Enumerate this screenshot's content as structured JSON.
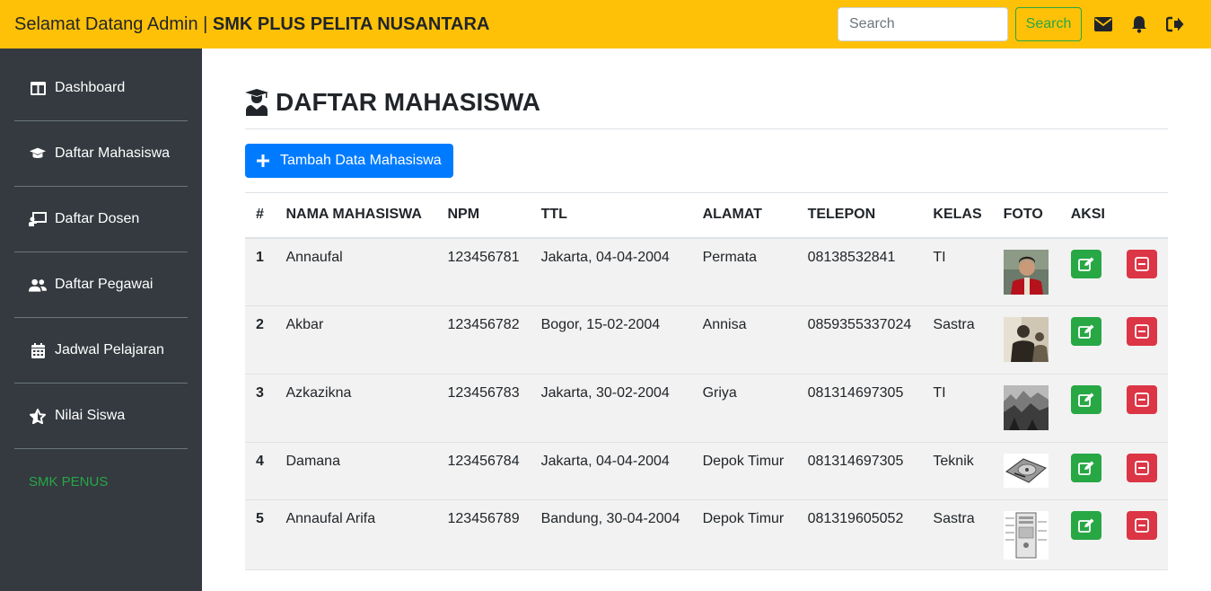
{
  "navbar": {
    "welcome": "Selamat Datang Admin | ",
    "school": "SMK PLUS PELITA NUSANTARA",
    "search_placeholder": "Search",
    "search_button": "Search",
    "icons": [
      "envelope-icon",
      "bell-icon",
      "sign-out-icon"
    ],
    "color": "#ffc107"
  },
  "sidebar": {
    "items": [
      {
        "label": "Dashboard",
        "icon": "columns-icon"
      },
      {
        "label": "Daftar Mahasiswa",
        "icon": "graduation-cap-icon"
      },
      {
        "label": "Daftar Dosen",
        "icon": "chalkboard-teacher-icon"
      },
      {
        "label": "Daftar Pegawai",
        "icon": "users-icon"
      },
      {
        "label": "Jadwal Pelajaran",
        "icon": "calendar-icon"
      },
      {
        "label": "Nilai Siswa",
        "icon": "star-icon"
      }
    ],
    "footer": "SMK PENUS"
  },
  "main": {
    "title": "DAFTAR MAHASISWA",
    "add_button": "Tambah Data Mahasiswa",
    "table": {
      "headers": [
        "#",
        "NAMA MAHASISWA",
        "NPM",
        "TTL",
        "ALAMAT",
        "TELEPON",
        "KELAS",
        "FOTO",
        "AKSI"
      ],
      "rows": [
        {
          "no": "1",
          "nama": "Annaufal",
          "npm": "123456781",
          "ttl": "Jakarta, 04-04-2004",
          "alamat": "Permata",
          "telepon": "08138532841",
          "kelas": "TI"
        },
        {
          "no": "2",
          "nama": "Akbar",
          "npm": "123456782",
          "ttl": "Bogor, 15-02-2004",
          "alamat": "Annisa",
          "telepon": "0859355337024",
          "kelas": "Sastra"
        },
        {
          "no": "3",
          "nama": "Azkazikna",
          "npm": "123456783",
          "ttl": "Jakarta, 30-02-2004",
          "alamat": "Griya",
          "telepon": "081314697305",
          "kelas": "TI"
        },
        {
          "no": "4",
          "nama": "Damana",
          "npm": "123456784",
          "ttl": "Jakarta, 04-04-2004",
          "alamat": "Depok Timur",
          "telepon": "081314697305",
          "kelas": "Teknik"
        },
        {
          "no": "5",
          "nama": "Annaufal Arifa",
          "npm": "123456789",
          "ttl": "Bandung, 30-04-2004",
          "alamat": "Depok Timur",
          "telepon": "081319605052",
          "kelas": "Sastra"
        }
      ]
    }
  },
  "colors": {
    "primary": "#007bff",
    "success": "#28a745",
    "danger": "#dc3545",
    "sidebar": "#343a40"
  }
}
